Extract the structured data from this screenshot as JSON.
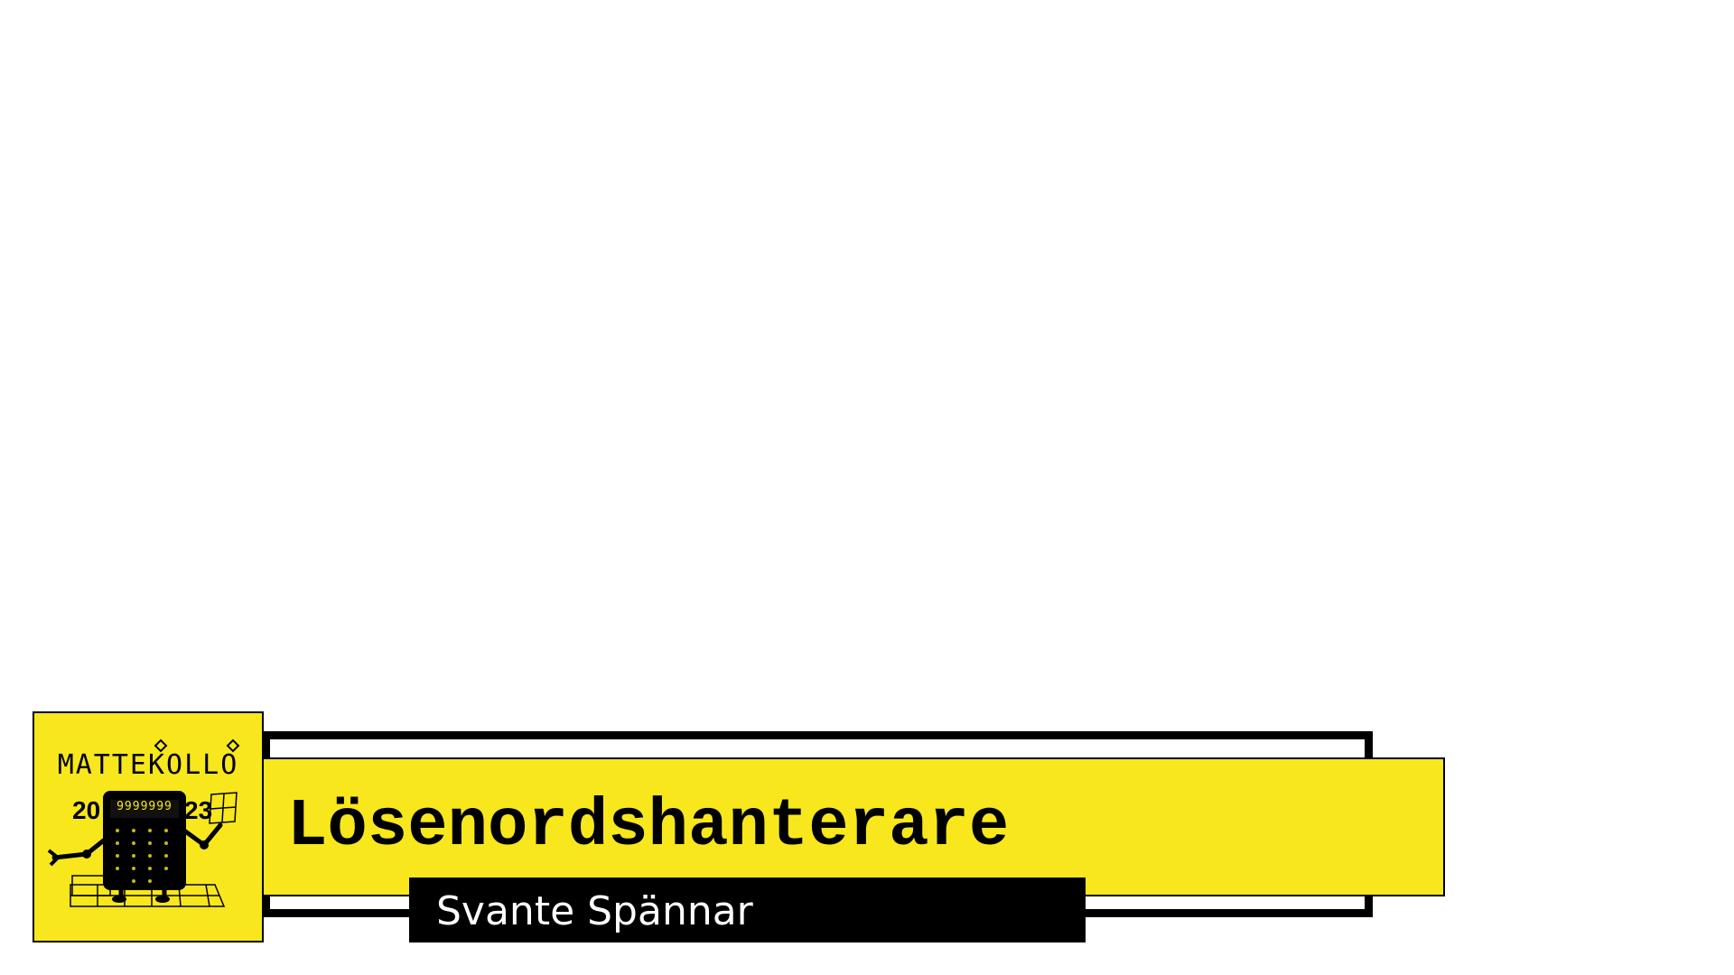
{
  "slide": {
    "title": "Lösenordshanterare",
    "author": "Svante Spännar"
  },
  "logo": {
    "wordmark": "MATTEKOLLO",
    "year_left": "20",
    "year_right": "23",
    "display_digits": "9999999"
  },
  "colors": {
    "accent_yellow": "#f8e71c",
    "black": "#000000",
    "background": "#ffffff"
  }
}
